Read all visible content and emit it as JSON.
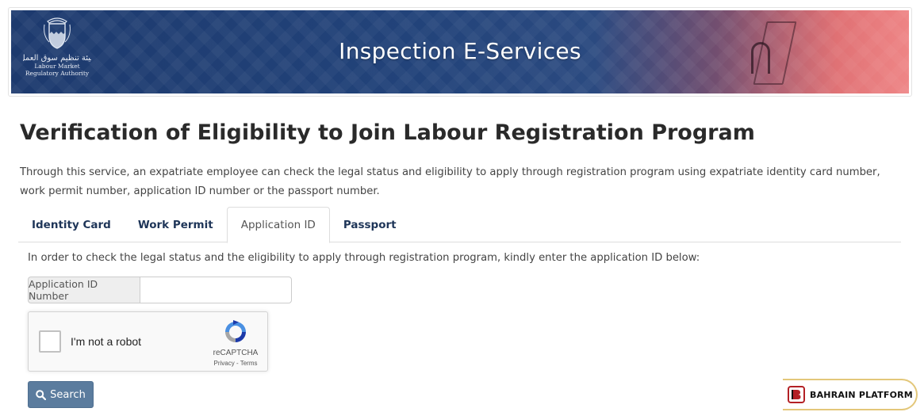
{
  "banner": {
    "title": "Inspection E-Services",
    "org_arabic": "هيئة تنظيم سوق العمل",
    "org_english_line1": "Labour Market",
    "org_english_line2": "Regulatory Authority",
    "colors": {
      "primary": "#1d3a6e",
      "accent": "#e86566"
    }
  },
  "page": {
    "title": "Verification of Eligibility to Join Labour Registration Program",
    "intro_line1": "Through this service, an expatriate employee can check the legal status and eligibility to apply through registration program using expatriate identity card number,",
    "intro_line2": "work permit number, application ID number or the passport number."
  },
  "tabs": [
    {
      "label": "Identity Card",
      "active": false
    },
    {
      "label": "Work Permit",
      "active": false
    },
    {
      "label": "Application ID",
      "active": true
    },
    {
      "label": "Passport",
      "active": false
    }
  ],
  "form": {
    "instruction": "In order to check the legal status and the eligibility to apply through registration program, kindly enter the application ID below:",
    "addon_label": "Application ID Number",
    "value": "",
    "placeholder": ""
  },
  "captcha": {
    "label": "I'm not a robot",
    "brand": "reCAPTCHA",
    "terms": "Privacy - Terms",
    "checked": false
  },
  "search_button": {
    "label": "Search",
    "icon": "search-icon",
    "color": "#5b7c9e"
  },
  "badge": {
    "text": "BAHRAIN PLATFORM",
    "icon": "bahrain-platform-logo-icon",
    "border_color": "#e3c77a"
  }
}
